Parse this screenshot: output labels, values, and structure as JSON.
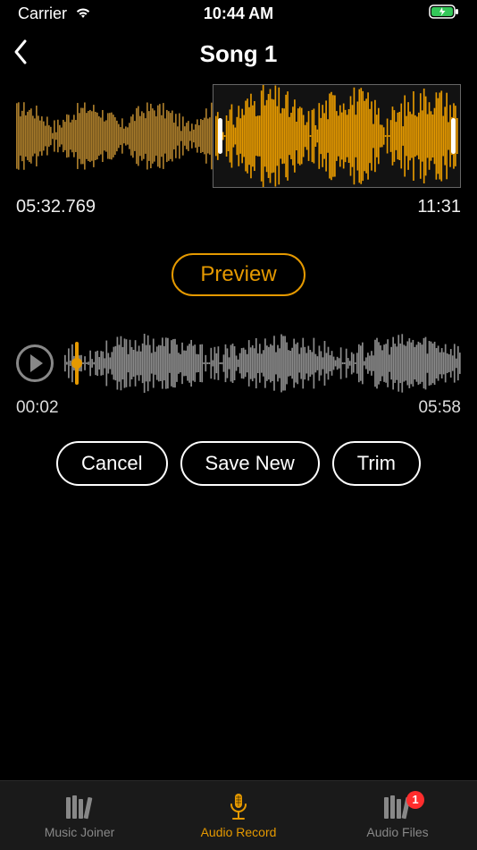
{
  "status": {
    "carrier": "Carrier",
    "time": "10:44 AM"
  },
  "header": {
    "title": "Song 1"
  },
  "main_waveform": {
    "time_start": "05:32.769",
    "time_end": "11:31"
  },
  "preview": {
    "label": "Preview"
  },
  "secondary": {
    "time_start": "00:02",
    "time_end": "05:58"
  },
  "actions": {
    "cancel": "Cancel",
    "save_new": "Save New",
    "trim": "Trim"
  },
  "tabs": {
    "music_joiner": "Music Joiner",
    "audio_record": "Audio Record",
    "audio_files": "Audio Files",
    "badge_count": "1"
  },
  "colors": {
    "accent": "#e59900",
    "waveform_left": "#a77a2a",
    "waveform_selected": "#e59900",
    "waveform_gray": "#8a8a8a"
  }
}
